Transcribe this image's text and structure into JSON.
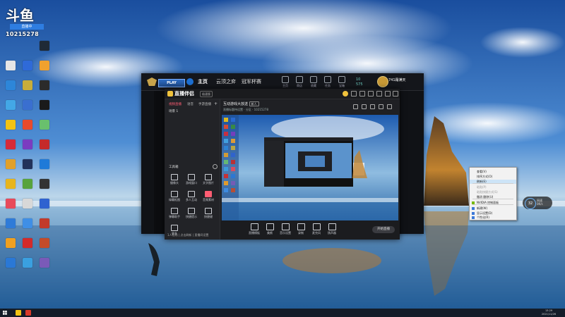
{
  "overlay": {
    "logo_text": "斗鱼",
    "tag": "直播中",
    "room_number": "10215278"
  },
  "desktop_icons": [
    {
      "label": "",
      "color": "#2b6cd6"
    },
    {
      "label": "",
      "color": "#3a8f3c"
    },
    {
      "label": "",
      "color": "#1f2a36"
    },
    {
      "label": "",
      "color": "#e6e6e6"
    },
    {
      "label": "",
      "color": "#2f6ad8"
    },
    {
      "label": "",
      "color": "#f0a12e"
    },
    {
      "label": "",
      "color": "#2d86d9"
    },
    {
      "label": "",
      "color": "#c8ad3a"
    },
    {
      "label": "",
      "color": "#2b2b2b"
    },
    {
      "label": "",
      "color": "#43a7e6"
    },
    {
      "label": "",
      "color": "#3a6fd0"
    },
    {
      "label": "",
      "color": "#1a1a1a"
    },
    {
      "label": "",
      "color": "#f2c314"
    },
    {
      "label": "",
      "color": "#e84a2c"
    },
    {
      "label": "",
      "color": "#69c06d"
    },
    {
      "label": "",
      "color": "#d72b39"
    },
    {
      "label": "",
      "color": "#7b3cc0"
    },
    {
      "label": "",
      "color": "#c52a2a"
    },
    {
      "label": "",
      "color": "#e1a02a"
    },
    {
      "label": "",
      "color": "#22325a"
    },
    {
      "label": "",
      "color": "#1f7ad8"
    },
    {
      "label": "",
      "color": "#e8b51e"
    },
    {
      "label": "",
      "color": "#58a33c"
    },
    {
      "label": "",
      "color": "#333333"
    },
    {
      "label": "",
      "color": "#e84a5a"
    },
    {
      "label": "",
      "color": "#d8d8d8"
    },
    {
      "label": "",
      "color": "#2f62d0"
    },
    {
      "label": "",
      "color": "#2f7bd8"
    },
    {
      "label": "",
      "color": "#3f8fe6"
    },
    {
      "label": "",
      "color": "#c23a2a"
    },
    {
      "label": "",
      "color": "#f0a020"
    },
    {
      "label": "",
      "color": "#d42a2a"
    },
    {
      "label": "",
      "color": "#c34b2a"
    },
    {
      "label": "",
      "color": "#2a78d6"
    },
    {
      "label": "",
      "color": "#3aa0e0"
    },
    {
      "label": "",
      "color": "#7a5ab8"
    }
  ],
  "launcher": {
    "play_label": "PLAY",
    "tabs": [
      "主页",
      "云顶之弈",
      "冠军杯赛"
    ],
    "nav": [
      "主页",
      "商店",
      "收藏",
      "任务",
      "宝箱",
      "朋友"
    ],
    "currency_rp": "10",
    "currency_be": "575",
    "username": "741霜满天"
  },
  "app": {
    "name": "直播伴侣",
    "version": "极速版",
    "left_tabs": [
      "视频直播",
      "语音",
      "手游直播"
    ],
    "scene": "场景 1",
    "tools_title": "工具箱",
    "tools": [
      "摄像头",
      "游戏窗口",
      "文字图片",
      "绿幕抠图",
      "多人互动",
      "音频素材",
      "弹幕助手",
      "快捷提示",
      "快捷键",
      "更多"
    ],
    "footer": "1人在线 | 点击刷新 | 直播间设置",
    "preview_title": "互动游戏大放送",
    "preview_tag": "新人",
    "preview_sub": "直播标题待设置 · 分区 · 10215278",
    "bottom_tools": [
      "直播模板",
      "美颜",
      "音乐设置",
      "录制",
      "麦克风",
      "扬声器"
    ],
    "start_live": "开始直播"
  },
  "context_menu": {
    "items": [
      {
        "label": "查看(V)",
        "disabled": false
      },
      {
        "label": "排序方式(O)",
        "disabled": false
      },
      {
        "label": "刷新(E)",
        "disabled": false,
        "highlight": true
      },
      {
        "label": "粘贴(P)",
        "disabled": true
      },
      {
        "label": "粘贴快捷方式(S)",
        "disabled": true
      },
      {
        "label": "撤消 删除(U)",
        "disabled": false
      },
      {
        "label": "NVIDIA 控制面板",
        "disabled": false
      },
      {
        "label": "新建(W)",
        "disabled": false
      },
      {
        "label": "显示设置(D)",
        "disabled": false
      },
      {
        "label": "个性化(R)",
        "disabled": false
      }
    ]
  },
  "perf_widget": {
    "value": "32",
    "label_line1": "网速",
    "label_line2": "0K/s"
  },
  "taskbar": {
    "apps": [
      {
        "color": "#f2c314"
      },
      {
        "color": "#d83a2a"
      }
    ],
    "time": "13:29",
    "date": "2021/11/26"
  }
}
